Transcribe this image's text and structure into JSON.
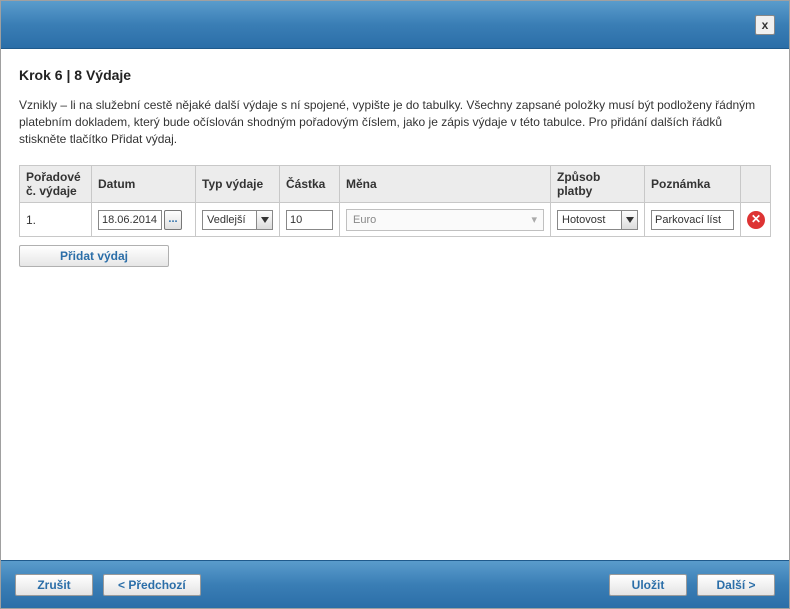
{
  "header": {
    "close_label": "x"
  },
  "step": {
    "title": "Krok 6 | 8 Výdaje",
    "instructions": "Vznikly – li na služební cestě nějaké další výdaje s ní spojené, vypište je do tabulky. Všechny zapsané položky musí být podloženy řádným platebním dokladem, který bude očíslován shodným pořadovým číslem, jako je zápis výdaje v této tabulce. Pro přidání dalších řádků stiskněte tlačítko Přidat výdaj."
  },
  "table": {
    "headers": {
      "order": "Pořadové č. výdaje",
      "date": "Datum",
      "type": "Typ výdaje",
      "amount": "Částka",
      "currency": "Měna",
      "payment": "Způsob platby",
      "note": "Poznámka"
    },
    "rows": [
      {
        "order": "1.",
        "date": "18.06.2014",
        "type": "Vedlejší",
        "amount": "10",
        "currency": "Euro",
        "payment": "Hotovost",
        "note": "Parkovací líst"
      }
    ],
    "picker_label": "...",
    "add_button": "Přidat výdaj"
  },
  "footer": {
    "cancel": "Zrušit",
    "prev": "< Předchozí",
    "save": "Uložit",
    "next": "Další >"
  }
}
